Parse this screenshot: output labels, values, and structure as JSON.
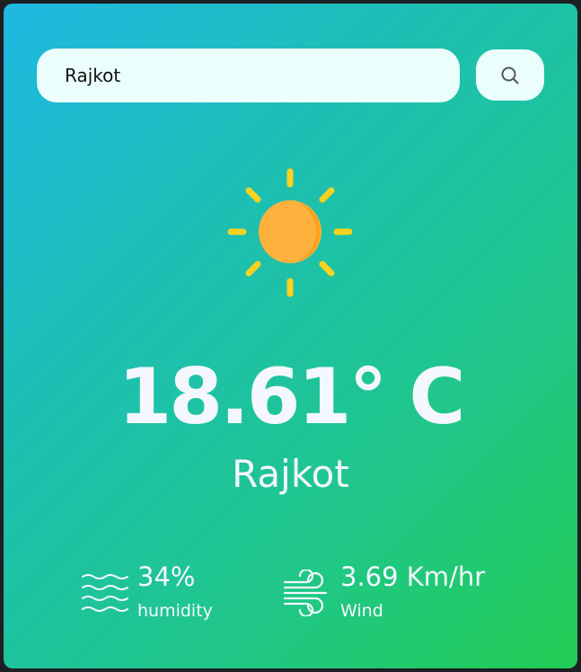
{
  "search": {
    "value": "Rajkot",
    "button_icon": "search-icon"
  },
  "weather": {
    "icon": "sun-icon",
    "temperature": "18.61° C",
    "city": "Rajkot"
  },
  "humidity": {
    "icon": "humidity-waves-icon",
    "value": "34%",
    "label": "humidity"
  },
  "wind": {
    "icon": "wind-icon",
    "value": "3.69 Km/hr",
    "label": "Wind"
  },
  "colors": {
    "gradient_start": "#1fb8e2",
    "gradient_end": "#22cc52",
    "input_bg": "#ebfffc",
    "sun": "#ffb13d",
    "sun_rays": "#ffd21f",
    "text": "#f4f7ff"
  }
}
